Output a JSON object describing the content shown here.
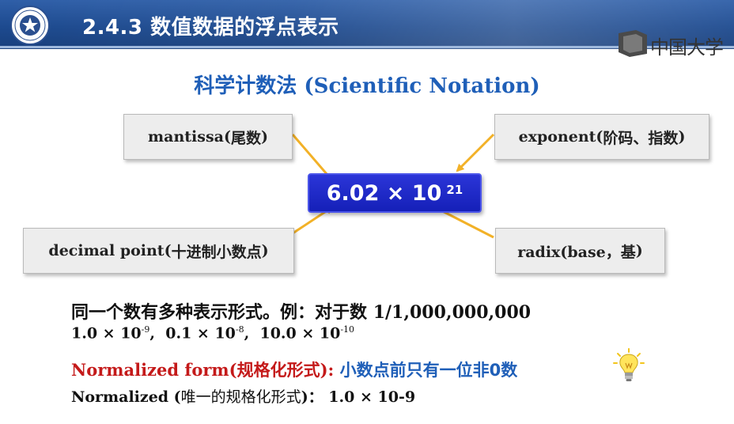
{
  "header": {
    "title": "2.4.3 数值数据的浮点表示",
    "brand_text": "中国大学"
  },
  "subtitle": {
    "cn": "科学计数法",
    "en": "(Scientific Notation)"
  },
  "boxes": {
    "mantissa": {
      "en": "mantissa(",
      "cn": "尾数",
      "close": ")"
    },
    "exponent": {
      "en": "exponent(",
      "cn": "阶码、指数",
      "close": ")"
    },
    "decimal": {
      "en": "decimal point(",
      "cn": "十进制小数点",
      "close": ")"
    },
    "radix": {
      "en": "radix(base，",
      "cn": "基",
      "close": ")"
    }
  },
  "formula": {
    "base": "6.02 × 10",
    "exponent": "21"
  },
  "lines": {
    "line1_cn": "同一个数有多种表示形式。例：对于数",
    "line1_num": "1/1,000,000,000",
    "line2": {
      "a": "1.0 × 10",
      "a_exp": "-9",
      "sep1": ",  ",
      "b": "0.1 × 10",
      "b_exp": "-8",
      "sep2": ",  ",
      "c": "10.0 × 10",
      "c_exp": "-10"
    },
    "line3_red_en": "Normalized form(",
    "line3_red_cn": "规格化形式",
    "line3_red_close": "):",
    "line3_blue": " 小数点前只有一位非0数",
    "line4_en": "Normalized (",
    "line4_cn": "唯一的规格化形式",
    "line4_close": ")：",
    "line4_value": " 1.0 × 10-9"
  },
  "colors": {
    "header_bg": "#1d4a8f",
    "accent_blue": "#1f5fb8",
    "formula_bg": "#1520b8",
    "red": "#c41a1a",
    "arrow": "#f2b127"
  },
  "icons": [
    "university-seal-icon",
    "mooc-logo-icon",
    "lightbulb-icon"
  ]
}
